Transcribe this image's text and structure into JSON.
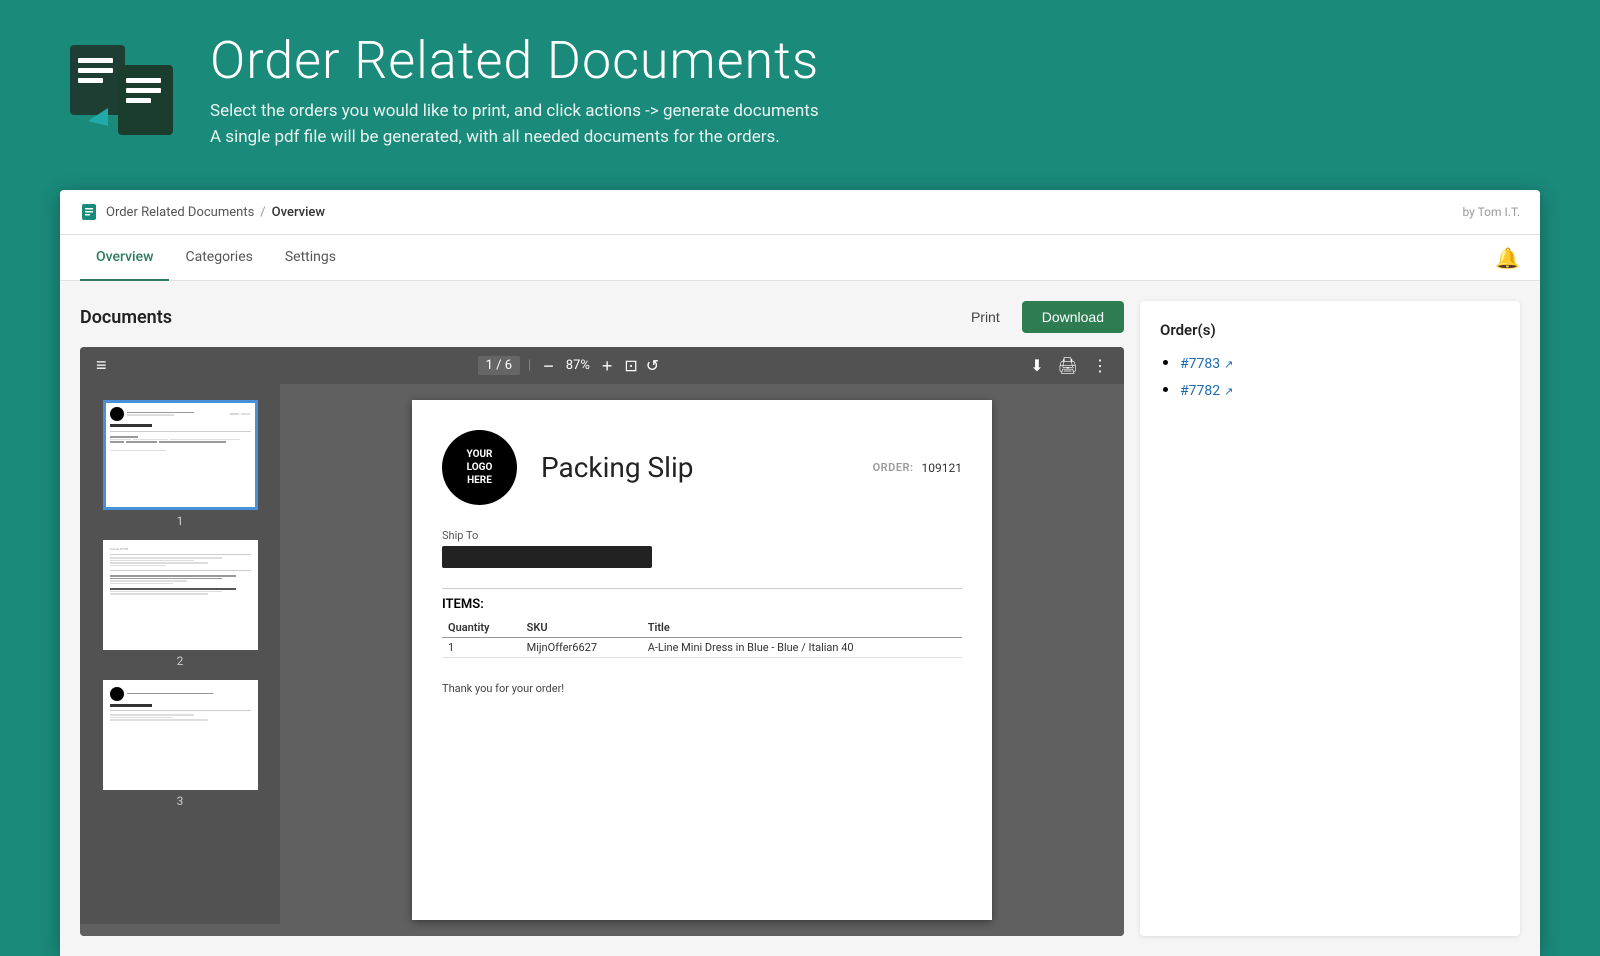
{
  "header": {
    "title": "Order Related Documents",
    "description_line1": "Select the orders you would like to print, and click actions -> generate documents",
    "description_line2": "A single pdf file will be generated, with all needed documents for the orders."
  },
  "breadcrumb": {
    "app_name": "Order Related Documents",
    "separator": "/",
    "current": "Overview"
  },
  "author": "by Tom I.T.",
  "nav": {
    "tabs": [
      {
        "label": "Overview",
        "active": true
      },
      {
        "label": "Categories",
        "active": false
      },
      {
        "label": "Settings",
        "active": false
      }
    ]
  },
  "documents_section": {
    "title": "Documents",
    "print_label": "Print",
    "download_label": "Download"
  },
  "pdf_viewer": {
    "page_current": 1,
    "page_total": 6,
    "zoom": "87%",
    "toolbar_menu_icon": "≡"
  },
  "pdf_page": {
    "logo_text": "YOUR\nLOGO\nHERE",
    "title": "Packing Slip",
    "order_label": "ORDER:",
    "order_number": "109121",
    "ship_to_label": "Ship To",
    "items_label": "ITEMS:",
    "table_headers": [
      "Quantity",
      "SKU",
      "Title"
    ],
    "table_rows": [
      [
        "1",
        "MijnOffer6627",
        "A-Line Mini Dress in Blue - Blue / Italian 40"
      ]
    ],
    "thank_you": "Thank you for your order!"
  },
  "orders_panel": {
    "title": "Order(s)",
    "orders": [
      {
        "id": "#7783",
        "url": "#"
      },
      {
        "id": "#7782",
        "url": "#"
      }
    ]
  },
  "thumbnails": [
    {
      "num": "1",
      "selected": true
    },
    {
      "num": "2",
      "selected": false
    },
    {
      "num": "3",
      "selected": false
    }
  ]
}
